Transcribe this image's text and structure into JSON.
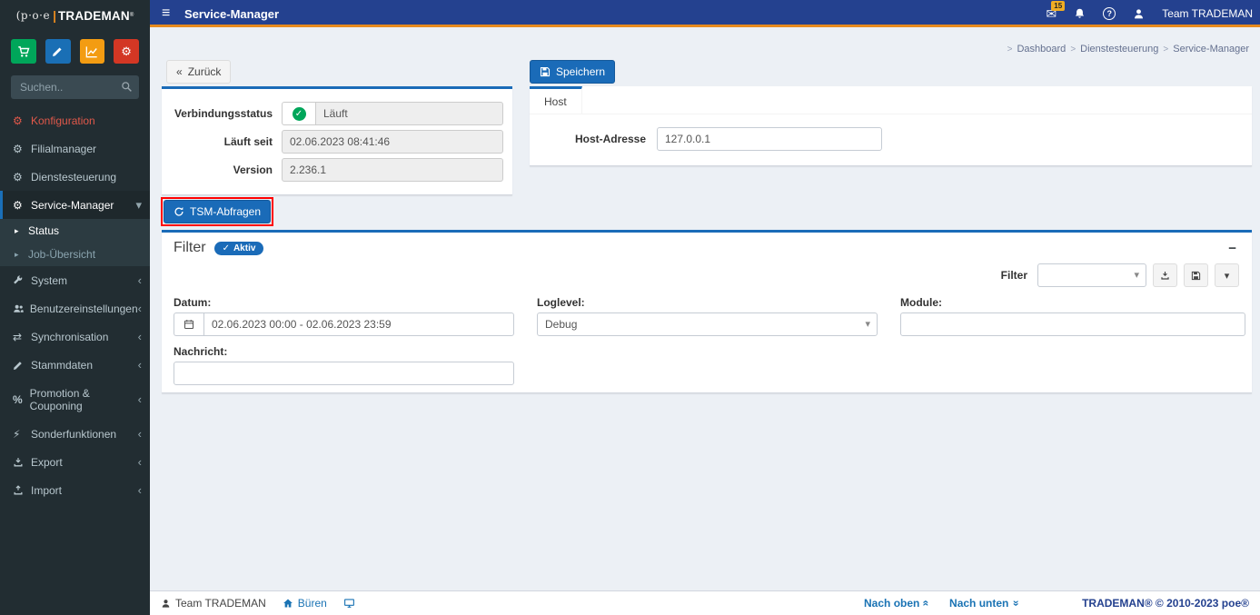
{
  "brand": {
    "prefix": "(p·o·e",
    "name": "TRADEMAN",
    "mark": "®"
  },
  "navbar": {
    "title": "Service-Manager",
    "mail_badge": "15",
    "user": "Team TRADEMAN"
  },
  "breadcrumb": {
    "separator": ">",
    "items": [
      "Dashboard",
      "Dienstesteuerung",
      "Service-Manager"
    ]
  },
  "sidebar": {
    "search_placeholder": "Suchen..",
    "items": [
      {
        "label": "Konfiguration"
      },
      {
        "label": "Filialmanager"
      },
      {
        "label": "Dienstesteuerung"
      },
      {
        "label": "Service-Manager"
      },
      {
        "label": "System"
      },
      {
        "label": "Benutzereinstellungen"
      },
      {
        "label": "Synchronisation"
      },
      {
        "label": "Stammdaten"
      },
      {
        "label": "Promotion & Couponing"
      },
      {
        "label": "Sonderfunktionen"
      },
      {
        "label": "Export"
      },
      {
        "label": "Import"
      }
    ],
    "submenu": [
      {
        "label": "Status"
      },
      {
        "label": "Job-Übersicht"
      }
    ]
  },
  "status_panel": {
    "back_label": "Zurück",
    "rows": [
      {
        "label": "Verbindungsstatus",
        "value": "Läuft"
      },
      {
        "label": "Läuft seit",
        "value": "02.06.2023 08:41:46"
      },
      {
        "label": "Version",
        "value": "2.236.1"
      }
    ]
  },
  "host_panel": {
    "save_label": "Speichern",
    "tab": "Host",
    "address_label": "Host-Adresse",
    "address_value": "127.0.0.1"
  },
  "tsm": {
    "label": "TSM-Abfragen"
  },
  "filter": {
    "title": "Filter",
    "badge": "Aktiv",
    "preset_label": "Filter",
    "preset_value": "",
    "datum_label": "Datum:",
    "datum_value": "02.06.2023 00:00 - 02.06.2023 23:59",
    "loglevel_label": "Loglevel:",
    "loglevel_value": "Debug",
    "module_label": "Module:",
    "module_value": "",
    "nachricht_label": "Nachricht:",
    "nachricht_value": ""
  },
  "footer": {
    "user": "Team TRADEMAN",
    "location": "Büren",
    "top": "Nach oben",
    "bottom": "Nach unten",
    "copyright": "TRADEMAN® © 2010-2023 poe®"
  },
  "icons": {
    "hamburger": "≡",
    "envelope": "✉",
    "question": "?",
    "gear": "⚙",
    "shuffle": "⇄",
    "percent": "%",
    "bolt": "⚡",
    "caret_down": "▾",
    "caret_left": "‹",
    "caret_right": "▸",
    "back": "«",
    "minus": "−",
    "check": "✓",
    "double_angle": "«"
  },
  "colors": {
    "navbar_blue": "#24418f",
    "accent_orange": "#e78a1e",
    "primary_blue": "#1a6bb8",
    "sidebar_dark": "#222d32",
    "success_green": "#00a65a",
    "annotation_red": "#ff0000"
  }
}
